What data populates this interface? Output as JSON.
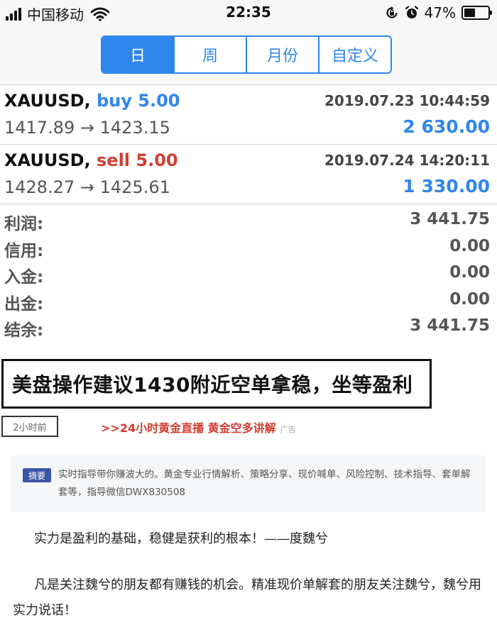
{
  "status_bar": {
    "carrier": "中国移动",
    "time": "22:35",
    "battery_percent": "47%",
    "battery_level": 0.47,
    "icons": [
      "signal-icon",
      "wifi-icon",
      "rotation-lock-icon",
      "alarm-icon",
      "battery-icon"
    ]
  },
  "period_tabs": [
    {
      "label": "日",
      "active": true
    },
    {
      "label": "周",
      "active": false
    },
    {
      "label": "月份",
      "active": false
    },
    {
      "label": "自定义",
      "active": false
    }
  ],
  "trades": [
    {
      "symbol": "XAUUSD,",
      "direction": "buy 5.00",
      "time": "2019.07.23 10:44:59",
      "prices": "1417.89 → 1423.15",
      "profit": "2 630.00"
    },
    {
      "symbol": "XAUUSD,",
      "direction": "sell 5.00",
      "time": "2019.07.24 14:20:11",
      "prices": "1428.27 → 1425.61",
      "profit": "1 330.00"
    }
  ],
  "summary": [
    {
      "label": "利润:",
      "value": "3 441.75"
    },
    {
      "label": "信用:",
      "value": "0.00"
    },
    {
      "label": "入金:",
      "value": "0.00"
    },
    {
      "label": "出金:",
      "value": "0.00"
    },
    {
      "label": "结余:",
      "value": "3 441.75"
    }
  ],
  "article": {
    "headline": "美盘操作建议1430附近空单拿稳，坐等盈利",
    "time_ago": "2小时前",
    "ad_link": ">>24小时黄金直播 黄金空多讲解",
    "ad_tag": "广告",
    "abstract_badge": "摘要",
    "abstract": "实时指导带你赚波大的。黄金专业行情解析、策略分享、现价喊单、风险控制、技术指导、套单解套等，指导微信DWX830508",
    "paragraphs": [
      "实力是盈利的基础，稳健是获利的根本！——度魏兮",
      "凡是关注魏兮的朋友都有赚钱的机会。精准现价单解套的朋友关注魏兮，魏兮用实力说话！"
    ]
  },
  "colors": {
    "accent": "#2f86ec",
    "sell": "#d23d32",
    "ad": "#d23d32"
  }
}
